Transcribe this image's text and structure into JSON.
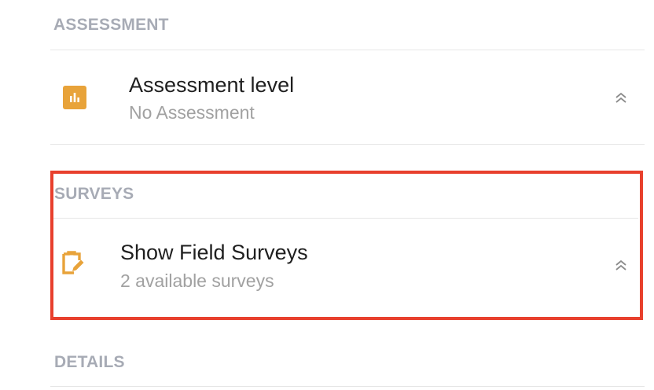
{
  "sections": {
    "assessment": {
      "header": "ASSESSMENT",
      "row": {
        "title": "Assessment level",
        "subtitle": "No Assessment",
        "icon": "bar-chart-icon",
        "chevron": "chevron-double-up-icon"
      }
    },
    "surveys": {
      "header": "SURVEYS",
      "row": {
        "title": "Show Field Surveys",
        "subtitle": "2 available surveys",
        "icon": "clipboard-edit-icon",
        "chevron": "chevron-double-up-icon"
      }
    },
    "details": {
      "header": "DETAILS"
    }
  },
  "colors": {
    "accent_icon": "#e8a33a",
    "highlight_border": "#e8402d",
    "section_header": "#a7abb5",
    "title_text": "#1f1f1f",
    "subtitle_text": "#a1a1a1",
    "divider": "#e6e6e6"
  }
}
